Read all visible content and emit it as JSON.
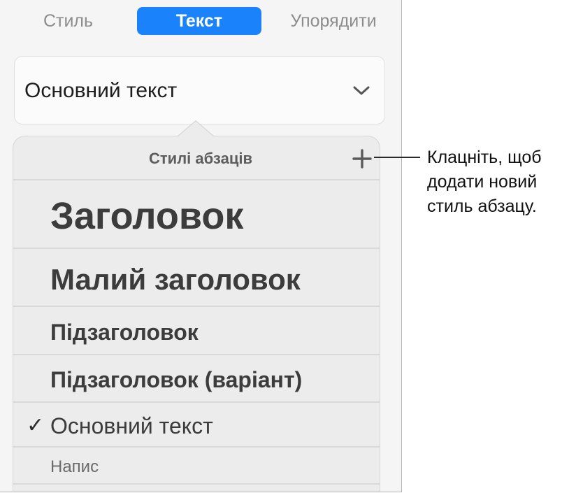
{
  "tabs": [
    {
      "label": "Стиль"
    },
    {
      "label": "Текст",
      "selected": true
    },
    {
      "label": "Упорядити"
    }
  ],
  "paragraph_style_select": {
    "value": "Основний текст"
  },
  "popover": {
    "title": "Стилі абзаців",
    "styles": [
      {
        "label": "Заголовок"
      },
      {
        "label": "Малий заголовок"
      },
      {
        "label": "Підзаголовок"
      },
      {
        "label": "Підзаголовок (варіант)"
      },
      {
        "label": "Основний текст",
        "checked": true
      },
      {
        "label": "Напис"
      }
    ],
    "checkmark": "✓"
  },
  "callout": {
    "text": "Клацніть, щоб\nдодати новий\nстиль абзацу."
  },
  "colors": {
    "accent": "#1a82fb"
  },
  "icons": [
    "chevron-down-icon",
    "plus-icon",
    "checkmark-icon"
  ]
}
